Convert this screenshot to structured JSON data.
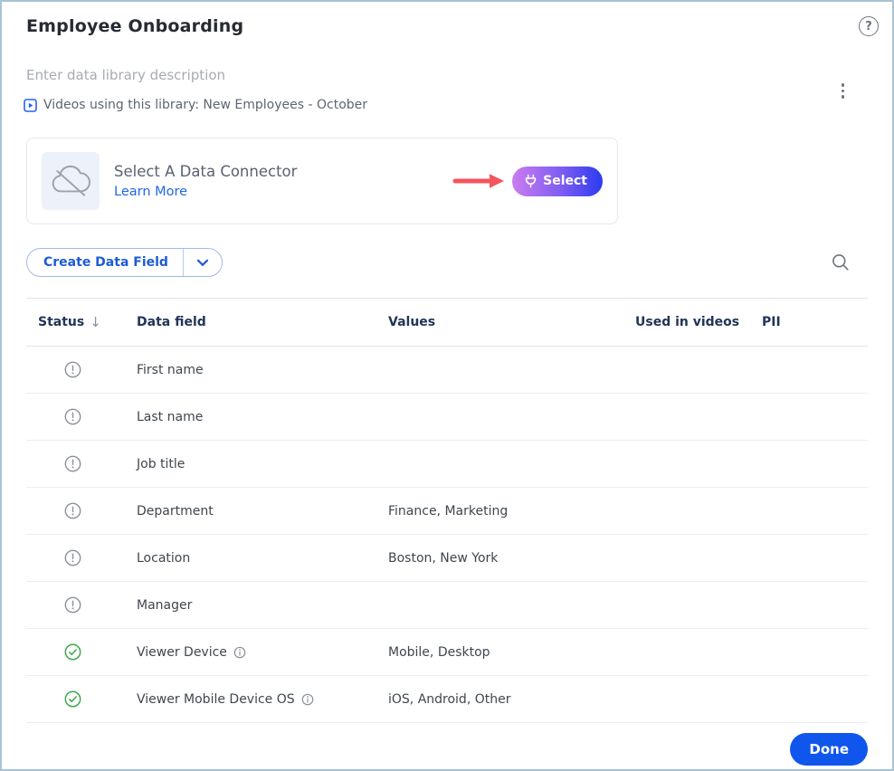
{
  "header": {
    "title": "Employee Onboarding",
    "description_placeholder": "Enter data library description",
    "videos_note": "Videos using this library: New Employees - October"
  },
  "connector_card": {
    "title": "Select A Data Connector",
    "learn_more_label": "Learn More",
    "select_button_label": "Select"
  },
  "toolbar": {
    "create_button_label": "Create Data Field"
  },
  "table": {
    "columns": [
      "Status",
      "Data field",
      "Values",
      "Used in videos",
      "PII"
    ],
    "sorted_column": "Status",
    "sort_direction": "desc",
    "rows": [
      {
        "status": "pending",
        "field": "First name",
        "values": "",
        "field_info": false
      },
      {
        "status": "pending",
        "field": "Last name",
        "values": "",
        "field_info": false
      },
      {
        "status": "pending",
        "field": "Job title",
        "values": "",
        "field_info": false
      },
      {
        "status": "pending",
        "field": "Department",
        "values": "Finance, Marketing",
        "field_info": false
      },
      {
        "status": "pending",
        "field": "Location",
        "values": "Boston, New York",
        "field_info": false
      },
      {
        "status": "pending",
        "field": "Manager",
        "values": "",
        "field_info": false
      },
      {
        "status": "ok",
        "field": "Viewer Device",
        "values": "Mobile, Desktop",
        "field_info": true
      },
      {
        "status": "ok",
        "field": "Viewer Mobile Device OS",
        "values": "iOS, Android, Other",
        "field_info": true
      }
    ]
  },
  "footer": {
    "done_button_label": "Done"
  },
  "colors": {
    "frame_border": "#a9c4d4",
    "accent_blue": "#1d5bd6",
    "link_blue": "#2067e8",
    "done_blue": "#1156ec",
    "select_gradient_start": "#cb7cef",
    "select_gradient_end": "#2b3bf0",
    "status_ok_green": "#3ea94b",
    "status_pending_gray": "#8b9099",
    "arrow_red": "#f4545e",
    "header_navy": "#233457"
  }
}
